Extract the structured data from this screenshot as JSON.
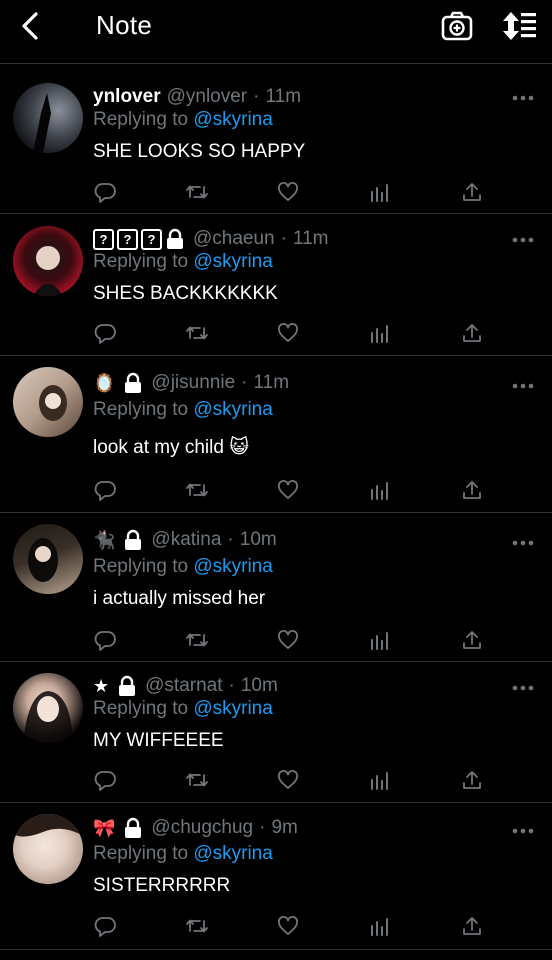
{
  "header": {
    "title": "Note",
    "back_icon": "chevron-left-icon",
    "camera_icon": "camera-plus-icon",
    "sort_icon": "sort-updown-icon"
  },
  "colors": {
    "background": "#000000",
    "text": "#e7e9ea",
    "muted": "#71767b",
    "link": "#1d9bf0",
    "divider": "#2f3336"
  },
  "replies": [
    {
      "display_name": "ynlover",
      "handle": "@ynlover",
      "sep": "·",
      "time": "11m",
      "replying_prefix": "Replying to",
      "replying_to": "@skyrina",
      "text": "SHE LOOKS SO HAPPY"
    },
    {
      "name_glyphs": [
        "?",
        "?",
        "?"
      ],
      "handle": "@chaeun",
      "sep": "·",
      "time": "11m",
      "replying_prefix": "Replying to",
      "replying_to": "@skyrina",
      "text": "SHES BACKKKKKKK"
    },
    {
      "name_emoji": "🪞",
      "handle": "@jisunnie",
      "sep": "·",
      "time": "11m",
      "replying_prefix": "Replying to",
      "replying_to": "@skyrina",
      "text": "look at my child 😺"
    },
    {
      "name_emoji": "🐈‍⬛",
      "handle": "@katina",
      "sep": "·",
      "time": "10m",
      "replying_prefix": "Replying to",
      "replying_to": "@skyrina",
      "text": "i actually missed her"
    },
    {
      "name_emoji": "★",
      "handle": "@starnat",
      "sep": "·",
      "time": "10m",
      "replying_prefix": "Replying to",
      "replying_to": "@skyrina",
      "text": "MY WIFFEEEE"
    },
    {
      "name_emoji": "🎀",
      "handle": "@chugchug",
      "sep": "·",
      "time": "9m",
      "replying_prefix": "Replying to",
      "replying_to": "@skyrina",
      "text": "SISTERRRRRR"
    }
  ],
  "action_icons": [
    "reply-icon",
    "retweet-icon",
    "like-icon",
    "analytics-icon",
    "share-icon"
  ]
}
